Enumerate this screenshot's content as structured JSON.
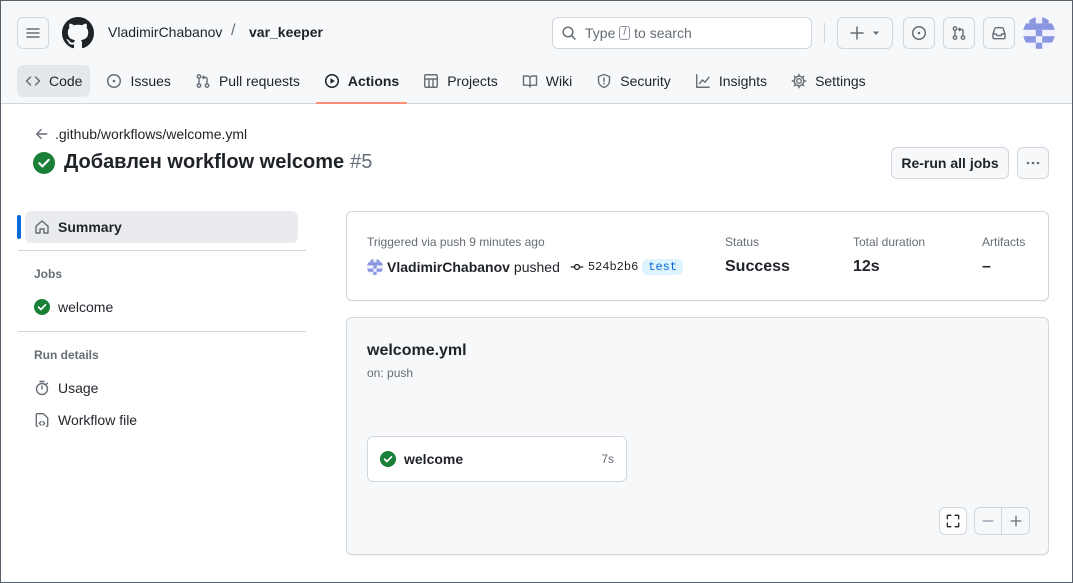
{
  "header": {
    "owner": "VladimirChabanov",
    "separator": "/",
    "repo": "var_keeper",
    "search": {
      "prefix": "Type",
      "key": "/",
      "suffix": "to search"
    }
  },
  "repo_nav": [
    {
      "label": "Code",
      "icon": "code-icon"
    },
    {
      "label": "Issues",
      "icon": "issue-opened-icon"
    },
    {
      "label": "Pull requests",
      "icon": "pull-request-icon"
    },
    {
      "label": "Actions",
      "icon": "play-icon"
    },
    {
      "label": "Projects",
      "icon": "table-icon"
    },
    {
      "label": "Wiki",
      "icon": "book-icon"
    },
    {
      "label": "Security",
      "icon": "shield-icon"
    },
    {
      "label": "Insights",
      "icon": "graph-icon"
    },
    {
      "label": "Settings",
      "icon": "gear-icon"
    }
  ],
  "run": {
    "back_path": ".github/workflows/welcome.yml",
    "title": "Добавлен workflow welcome",
    "number": "#5",
    "rerun_label": "Re-run all jobs"
  },
  "sidebar": {
    "summary": "Summary",
    "jobs_heading": "Jobs",
    "jobs": [
      {
        "label": "welcome",
        "status": "success"
      }
    ],
    "run_details_heading": "Run details",
    "details": [
      {
        "label": "Usage",
        "icon": "stopwatch-icon"
      },
      {
        "label": "Workflow file",
        "icon": "file-code-icon"
      }
    ]
  },
  "summary_card": {
    "triggered": "Triggered via push 9 minutes ago",
    "actor": "VladimirChabanov",
    "verb": "pushed",
    "commit": "524b2b6",
    "branch": "test",
    "status_label": "Status",
    "status_value": "Success",
    "duration_label": "Total duration",
    "duration_value": "12s",
    "artifacts_label": "Artifacts",
    "artifacts_value": "–"
  },
  "graph": {
    "workflow_file": "welcome.yml",
    "trigger": "on: push",
    "job": {
      "name": "welcome",
      "duration": "7s"
    }
  },
  "colors": {
    "success": "#1a7f37",
    "accent": "#0969da",
    "active_underline": "#fd8c73"
  }
}
